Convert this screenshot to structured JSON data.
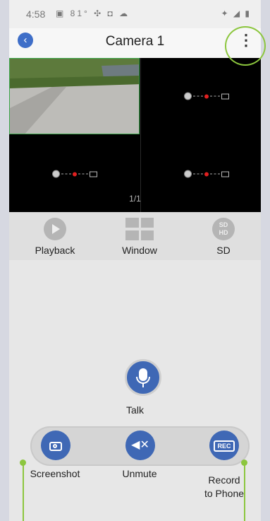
{
  "status_bar": {
    "time": "4:58",
    "left_icons": "▣ 81° ✣ ◘ ☁",
    "right_icons": "✦ ◢ ▮"
  },
  "header": {
    "title": "Camera 1",
    "back_icon": "chevron-left-icon",
    "more_icon": "more-vertical-icon",
    "more_glyph": "⋮"
  },
  "video_grid": {
    "page_indicator": "1/1"
  },
  "tools": [
    {
      "label": "Playback",
      "icon": "play-icon"
    },
    {
      "label": "Window",
      "icon": "grid-icon"
    },
    {
      "label": "SD",
      "icon": "sd-hd-icon",
      "glyph": "SD\nHD"
    }
  ],
  "talk": {
    "label": "Talk",
    "icon": "microphone-icon"
  },
  "actions": [
    {
      "label": "Screenshot",
      "icon": "camera-icon"
    },
    {
      "label": "Unmute",
      "icon": "muted-speaker-icon",
      "glyph": "◀✕"
    },
    {
      "label_line1": "Record",
      "label_line2": "to Phone",
      "icon": "record-icon",
      "glyph": "REC"
    }
  ],
  "colors": {
    "accent": "#3f68b5",
    "highlight": "#8cc63e"
  }
}
